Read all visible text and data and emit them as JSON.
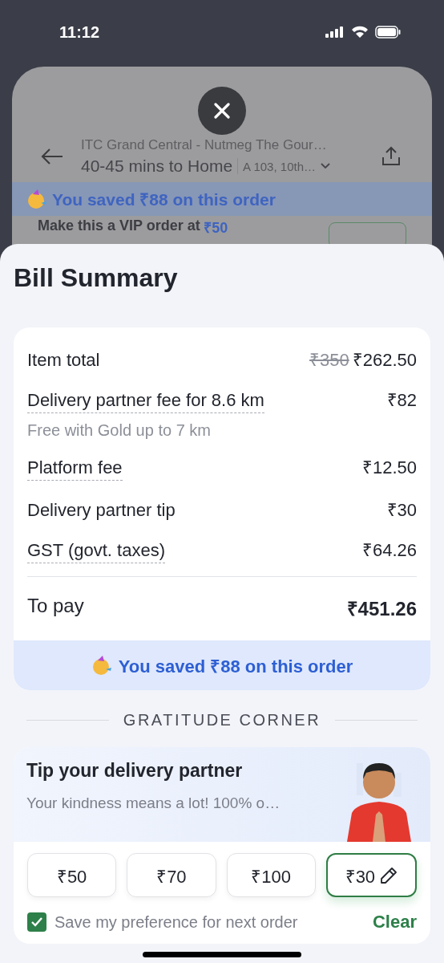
{
  "status_bar": {
    "time": "11:12"
  },
  "background": {
    "restaurant": "ITC Grand Central - Nutmeg The Gour…",
    "eta": "40-45 mins to Home",
    "address": "A 103, 10th…",
    "savings_banner": "You saved ₹88 on this order",
    "vip_prompt": "Make this a VIP order at",
    "vip_price": "₹50"
  },
  "bill": {
    "title": "Bill Summary",
    "rows": [
      {
        "label": "Item total",
        "original": "₹350",
        "value": "₹262.50",
        "underlined": false
      },
      {
        "label": "Delivery partner fee for 8.6 km",
        "value": "₹82",
        "note": "Free with Gold up to 7 km",
        "underlined": true
      },
      {
        "label": "Platform fee",
        "value": "₹12.50",
        "underlined": true
      },
      {
        "label": "Delivery partner tip",
        "value": "₹30",
        "underlined": false
      },
      {
        "label": "GST (govt. taxes)",
        "value": "₹64.26",
        "underlined": true
      }
    ],
    "total": {
      "label": "To pay",
      "value": "₹451.26"
    },
    "savings": "You saved ₹88 on this order"
  },
  "gratitude": {
    "heading": "GRATITUDE CORNER",
    "title": "Tip your delivery partner",
    "subtitle": "Your kindness means a lot! 100% o…",
    "tips": [
      {
        "label": "₹50",
        "selected": false,
        "editable": false
      },
      {
        "label": "₹70",
        "selected": false,
        "editable": false
      },
      {
        "label": "₹100",
        "selected": false,
        "editable": false
      },
      {
        "label": "₹30",
        "selected": true,
        "editable": true
      }
    ],
    "save_preference": {
      "label": "Save my preference for next order",
      "checked": true
    },
    "clear": "Clear"
  }
}
